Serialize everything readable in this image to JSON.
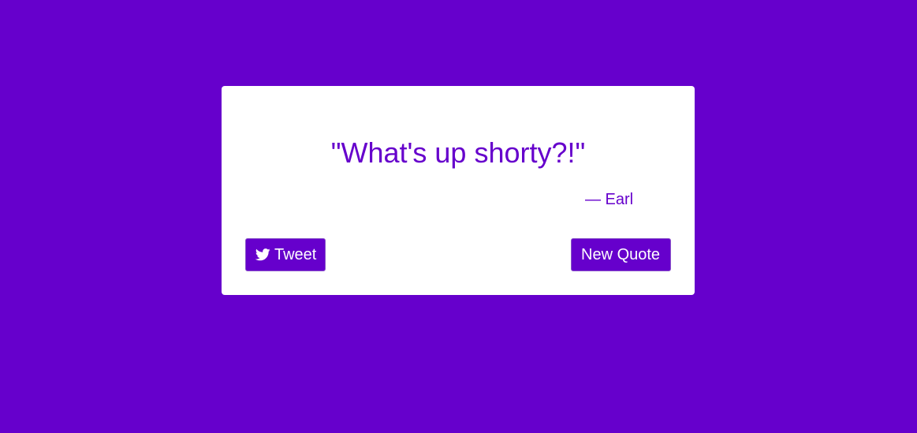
{
  "quote": {
    "text": "\"What's up shorty?!\"",
    "author": "— Earl"
  },
  "buttons": {
    "tweet_label": "Tweet",
    "tweet_icon": "twitter-bird-icon",
    "new_quote_label": "New Quote"
  },
  "colors": {
    "background": "#6600cc",
    "card": "#ffffff",
    "accent": "#6600cc"
  }
}
